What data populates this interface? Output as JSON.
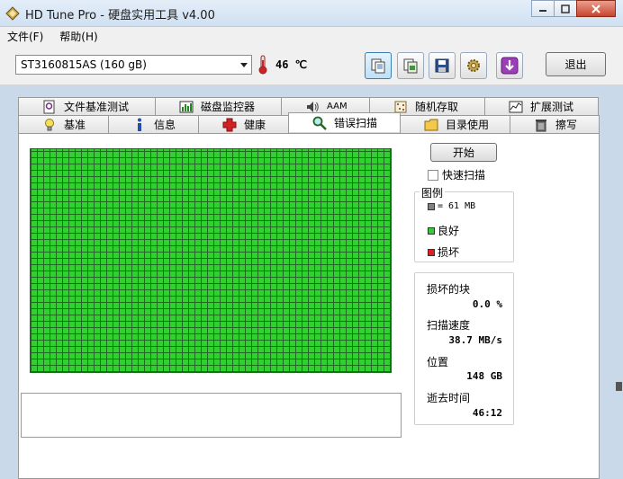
{
  "window": {
    "title": "HD Tune Pro - 硬盘实用工具 v4.00",
    "controls": {
      "minimize": "▭",
      "maximize": "□",
      "close": "✕"
    }
  },
  "menu": {
    "items": [
      {
        "label": "文件(F)"
      },
      {
        "label": "帮助(H)"
      }
    ]
  },
  "toolbar": {
    "drive": "ST3160815AS (160 gB)",
    "temperature": "46 ℃",
    "exit_label": "退出",
    "buttons": [
      "copy-info",
      "copy-screen",
      "save",
      "options",
      "download"
    ]
  },
  "tabs": {
    "back_row": [
      {
        "label": "文件基准测试",
        "icon": "file-benchmark-icon"
      },
      {
        "label": "磁盘监控器",
        "icon": "disk-monitor-icon"
      },
      {
        "label": "AAM",
        "icon": "speaker-icon"
      },
      {
        "label": "随机存取",
        "icon": "random-access-icon"
      },
      {
        "label": "扩展测试",
        "icon": "extra-tests-icon"
      }
    ],
    "front_row": [
      {
        "label": "基准",
        "icon": "lightbulb-icon"
      },
      {
        "label": "信息",
        "icon": "info-icon"
      },
      {
        "label": "健康",
        "icon": "health-cross-icon"
      },
      {
        "label": "错误扫描",
        "icon": "magnifier-icon"
      },
      {
        "label": "目录使用",
        "icon": "folder-icon"
      },
      {
        "label": "擦写",
        "icon": "trash-icon"
      }
    ]
  },
  "scan": {
    "start_label": "开始",
    "quick_scan_label": "快速扫描",
    "quick_scan_checked": false,
    "legend": {
      "title": "图例",
      "block_size": "= 61 MB",
      "good_label": "良好",
      "bad_label": "损坏",
      "block_color": "#808080",
      "good_color": "#2fd02f",
      "bad_color": "#e02020"
    },
    "stats": {
      "damaged_label": "损坏的块",
      "damaged_value": "0.0 %",
      "speed_label": "扫描速度",
      "speed_value": "38.7 MB/s",
      "position_label": "位置",
      "position_value": "148 GB",
      "elapsed_label": "逝去时间",
      "elapsed_value": "46:12"
    }
  }
}
